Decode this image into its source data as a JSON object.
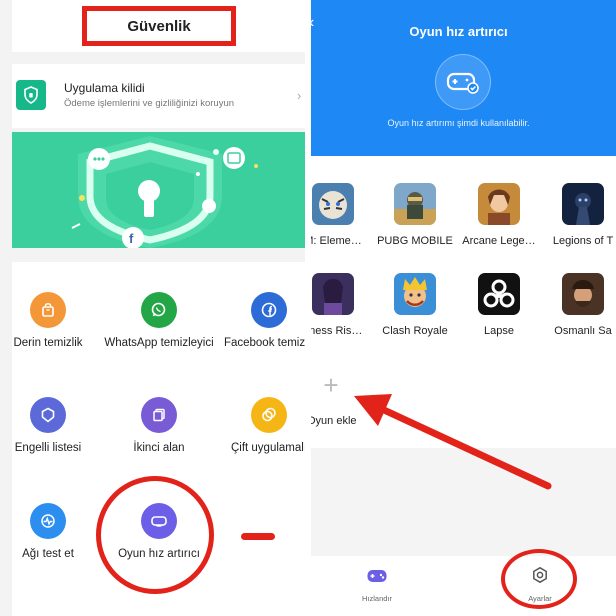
{
  "left": {
    "title": "Güvenlik",
    "app_lock": {
      "title": "Uygulama kilidi",
      "subtitle": "Ödeme işlemlerini ve gizliliğinizi koruyun",
      "chevron": "›"
    },
    "tools": [
      {
        "label": "Derin temizlik",
        "icon": "bag-icon",
        "color": "#f49738"
      },
      {
        "label": "WhatsApp temizleyici",
        "icon": "whatsapp-icon",
        "color": "#23a646"
      },
      {
        "label": "Facebook temizle",
        "icon": "facebook-icon",
        "color": "#2d6bd6"
      },
      {
        "label": "Engelli listesi",
        "icon": "shield-icon",
        "color": "#5b6ad8"
      },
      {
        "label": "İkinci alan",
        "icon": "copy-icon",
        "color": "#7a5bd6"
      },
      {
        "label": "Çift uygulamalı",
        "icon": "dual-circle-icon",
        "color": "#f5b615"
      },
      {
        "label": "Ağı test et",
        "icon": "network-test-icon",
        "color": "#2c8ff0"
      },
      {
        "label": "Oyun hız artırıcı",
        "icon": "gamepad-icon",
        "color": "#6c5ee6"
      }
    ]
  },
  "right": {
    "back_glyph": "‹",
    "title": "Oyun hız artırıcı",
    "subtitle": "Oyun hız artırımı şimdi kullanılabilir.",
    "games": [
      {
        "name": "M: Eleme…"
      },
      {
        "name": "PUBG MOBILE"
      },
      {
        "name": "Arcane Lege…"
      },
      {
        "name": "Legions of T"
      },
      {
        "name": "kness Ris…"
      },
      {
        "name": "Clash Royale"
      },
      {
        "name": "Lapse"
      },
      {
        "name": "Osmanlı Sa"
      }
    ],
    "add_glyph": "+",
    "add_label": "Oyun ekle",
    "bottom_nav": [
      {
        "label": "Hızlandır",
        "icon": "gamepad-icon",
        "color": "#6c5ee6"
      },
      {
        "label": "Ayarlar",
        "icon": "settings-icon",
        "color": "#555555"
      }
    ]
  },
  "annotation_color": "#e2231a"
}
